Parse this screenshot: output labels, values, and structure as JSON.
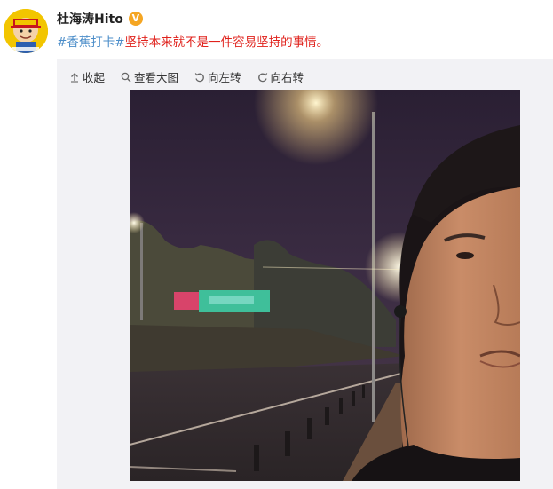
{
  "post": {
    "username": "杜海涛Hito",
    "verified_badge": "V",
    "hashtag": "#香蕉打卡#",
    "text": "坚持本来就不是一件容易坚持的事情。"
  },
  "toolbar": {
    "collapse_label": "收起",
    "view_large_label": "查看大图",
    "rotate_left_label": "向左转",
    "rotate_right_label": "向右转"
  },
  "icons": {
    "collapse": "up-arrow-icon",
    "view_large": "magnifier-icon",
    "rotate_left": "rotate-left-icon",
    "rotate_right": "rotate-right-icon"
  },
  "colors": {
    "hashtag": "#4b8dc9",
    "post_text": "#e0221c",
    "verified": "#f5a623",
    "panel_bg": "#f2f2f5"
  }
}
